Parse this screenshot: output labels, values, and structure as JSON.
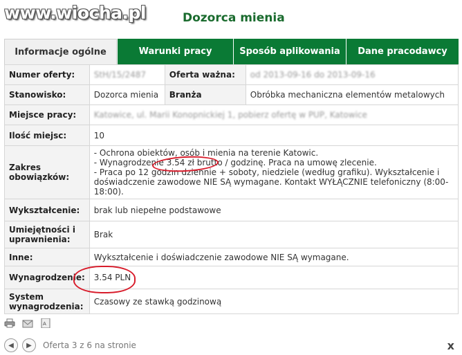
{
  "watermark": "www.wiocha.pl",
  "page_title": "Dozorca mienia",
  "tabs": [
    {
      "label": "Informacje ogólne",
      "active": true
    },
    {
      "label": "Warunki pracy",
      "active": false
    },
    {
      "label": "Sposób aplikowania",
      "active": false
    },
    {
      "label": "Dane pracodawcy",
      "active": false
    }
  ],
  "rows": {
    "offer_number": {
      "label": "Numer oferty:",
      "value": "StH/15/2487"
    },
    "offer_valid": {
      "label": "Oferta ważna:",
      "value": "od 2013-09-16 do 2013-09-16"
    },
    "position": {
      "label": "Stanowisko:",
      "value": "Dozorca mienia"
    },
    "industry": {
      "label": "Branża",
      "value": "Obróbka mechaniczna elementów metalowych"
    },
    "location": {
      "label": "Miejsce pracy:",
      "value": "Katowice, ul. Marii Konopnickiej 1, pobierz ofertę w PUP, Katowice"
    },
    "places": {
      "label": "Ilość miejsc:",
      "value": "10"
    },
    "duties": {
      "label": "Zakres obowiązków:",
      "lines": [
        "- Ochrona obiektów, osób i mienia na terenie Katowic.",
        "- Wynagrodzenie 3.54 zł brutto / godzinę. Praca na umowę zlecenie.",
        "- Praca po 12 godzin dziennie + soboty, niedziele (według grafiku). Wykształcenie i",
        "doświadczenie zawodowe NIE SĄ wymagane. Kontakt WYŁĄCZNIE telefoniczny (8:00-18:00)."
      ]
    },
    "education": {
      "label": "Wykształcenie:",
      "value": "brak lub niepełne podstawowe"
    },
    "skills": {
      "label": "Umiejętności i uprawnienia:",
      "value": "Brak"
    },
    "other": {
      "label": "Inne:",
      "value": "Wykształcenie i doświadczenie zawodowe NIE SĄ wymagane."
    },
    "salary": {
      "label": "Wynagrodzenie:",
      "value": "3.54 PLN"
    },
    "pay_system": {
      "label": "System wynagrodzenia:",
      "value": "Czasowy ze stawką godzinową"
    }
  },
  "footer_icons": [
    "printer-icon",
    "email-icon",
    "pdf-icon"
  ],
  "nav": {
    "status": "Oferta 3 z 6 na stronie",
    "prev_icon": "arrow-left-icon",
    "next_icon": "arrow-right-icon",
    "close": "x"
  },
  "colors": {
    "tab_green": "#0a7a35",
    "title_green": "#1a6b2e",
    "annotation_red": "#d81c2b"
  }
}
